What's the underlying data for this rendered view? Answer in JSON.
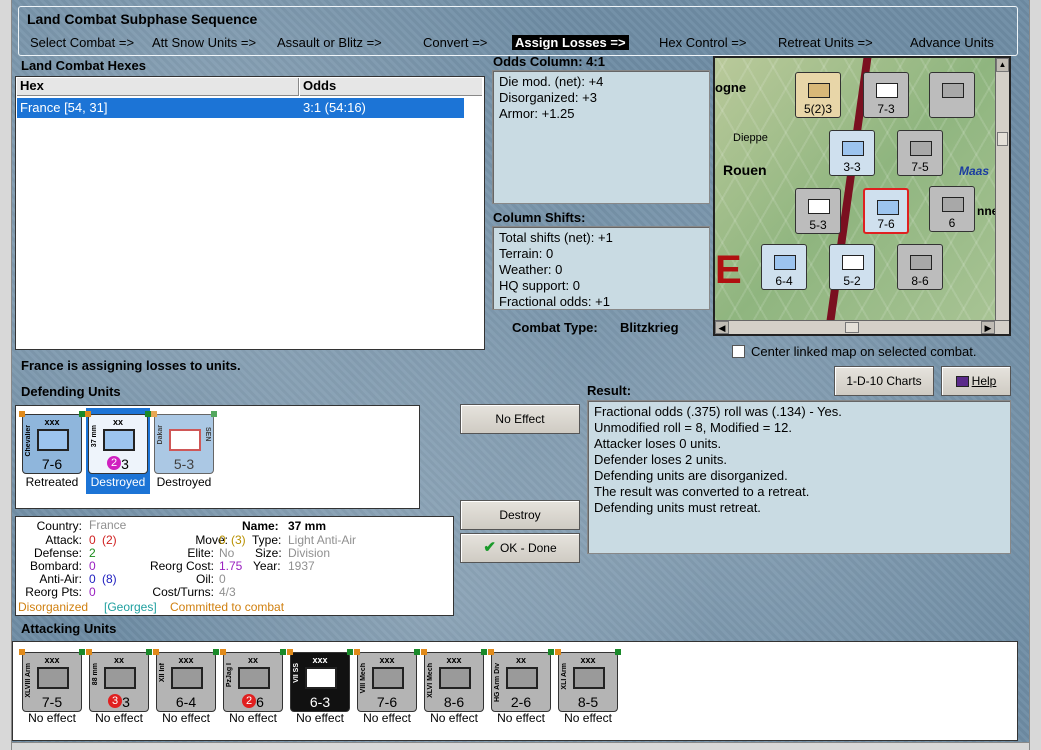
{
  "subphase": {
    "title": "Land Combat Subphase Sequence",
    "steps": [
      "Select Combat =>",
      "Att Snow Units =>",
      "Assault or Blitz =>",
      "Convert =>",
      "Assign Losses =>",
      "Hex Control =>",
      "Retreat Units =>",
      "Advance Units"
    ],
    "active_index": 4
  },
  "hexes": {
    "title": "Land Combat Hexes",
    "col_hex": "Hex",
    "col_odds": "Odds",
    "rows": [
      {
        "hex": "France [54, 31]",
        "odds": "3:1 (54:16)"
      }
    ]
  },
  "odds_column": {
    "title": "Odds Column: 4:1",
    "lines": [
      "Die mod. (net): +4",
      "Disorganized: +3",
      "Armor: +1.25"
    ]
  },
  "column_shifts": {
    "title": "Column Shifts:",
    "lines": [
      "Total shifts (net): +1",
      "Terrain: 0",
      "Weather: 0",
      "HQ support: 0",
      "Fractional odds: +1"
    ]
  },
  "combat_type": {
    "label": "Combat Type:",
    "value": "Blitzkrieg"
  },
  "map": {
    "labels": [
      "ogne",
      "Dieppe",
      "Rouen",
      "Maas",
      "nne",
      "E"
    ],
    "center_linked_label": "Center linked map on selected combat."
  },
  "status_text": "France is assigning losses to units.",
  "defending": {
    "title": "Defending Units",
    "units": [
      {
        "name": "Chevalier",
        "size": "xxx",
        "strength": "7-6",
        "status": "Retreated",
        "selected": false
      },
      {
        "name": "37 mm",
        "size": "xx",
        "strength": "3",
        "disorg": "2",
        "status": "Destroyed",
        "selected": true
      },
      {
        "name": "Dakar",
        "size": "",
        "code": "SEN",
        "strength": "5-3",
        "status": "Destroyed",
        "selected": false
      }
    ]
  },
  "buttons": {
    "charts": "1-D-10 Charts",
    "help": "Help",
    "no_effect": "No Effect",
    "destroy": "Destroy",
    "ok_done": "OK - Done"
  },
  "result": {
    "title": "Result:",
    "lines": [
      "Fractional odds (.375) roll was (.134)  - Yes.",
      "Unmodified roll = 8, Modified = 12.",
      "Attacker loses 0 units.",
      "Defender loses 2 units.",
      "Defending units are disorganized.",
      "The result was converted to a retreat.",
      "Defending units must retreat."
    ]
  },
  "details": {
    "name_label": "Name:",
    "name": "37 mm",
    "country_label": "Country:",
    "country": "France",
    "attack_label": "Attack:",
    "attack": "0",
    "attack_extra": "(2)",
    "defense_label": "Defense:",
    "defense": "2",
    "bombard_label": "Bombard:",
    "bombard": "0",
    "antiair_label": "Anti-Air:",
    "antiair": "0",
    "antiair_extra": "(8)",
    "reorg_pts_label": "Reorg Pts:",
    "reorg_pts": "0",
    "move_label": "Move:",
    "move": "0",
    "move_extra": "(3)",
    "elite_label": "Elite:",
    "elite": "No",
    "reorg_cost_label": "Reorg Cost:",
    "reorg_cost": "1.75",
    "oil_label": "Oil:",
    "oil": "0",
    "cost_turns_label": "Cost/Turns:",
    "cost_turns": "4/3",
    "type_label": "Type:",
    "type": "Light Anti-Air",
    "size_label": "Size:",
    "size": "Division",
    "year_label": "Year:",
    "year": "1937",
    "flags": [
      "Disorganized",
      "[Georges]",
      "Committed to combat"
    ]
  },
  "attacking": {
    "title": "Attacking Units",
    "units": [
      {
        "name": "XLVIII Arm",
        "size": "xxx",
        "strength": "7-5",
        "status": "No effect"
      },
      {
        "name": "88 mm",
        "size": "xx",
        "strength": "3",
        "disorg": "3",
        "status": "No effect"
      },
      {
        "name": "XII Inf",
        "size": "xxx",
        "strength": "6-4",
        "status": "No effect"
      },
      {
        "name": "PzJag I",
        "size": "xx",
        "strength": "6",
        "disorg": "2",
        "status": "No effect"
      },
      {
        "name": "VII SS",
        "size": "xxx",
        "strength": "6-3",
        "status": "No effect",
        "ss": true
      },
      {
        "name": "VIII Mech",
        "size": "xxx",
        "strength": "7-6",
        "status": "No effect"
      },
      {
        "name": "XLVI Mech",
        "size": "xxx",
        "strength": "8-6",
        "status": "No effect"
      },
      {
        "name": "HG Arm Div",
        "size": "xx",
        "strength": "2-6",
        "status": "No effect"
      },
      {
        "name": "XLI Arm",
        "size": "xxx",
        "strength": "8-5",
        "status": "No effect"
      }
    ]
  },
  "colors": {
    "attack_red": "#d02020",
    "defense_green": "#1a8a1a",
    "purple": "#9a20c0",
    "blue": "#2020c0",
    "orange": "#d08010",
    "teal": "#20a0a0",
    "grey": "#909090"
  }
}
